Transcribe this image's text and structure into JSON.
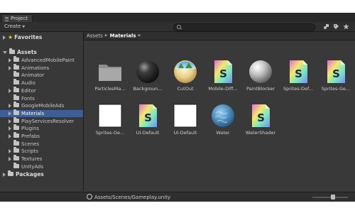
{
  "window": {
    "tab_title": "Project"
  },
  "toolbar": {
    "create_label": "Create",
    "search_value": "",
    "icons": [
      "search-icon",
      "filter-by-type-icon",
      "filter-by-label-icon",
      "favorites-star-icon"
    ]
  },
  "tree": {
    "favorites_label": "Favorites",
    "assets_label": "Assets",
    "packages_label": "Packages",
    "items": [
      {
        "label": "AdvancedMobilePaint",
        "expandable": true,
        "selected": false
      },
      {
        "label": "Animations",
        "expandable": true,
        "selected": false
      },
      {
        "label": "Animator",
        "expandable": false,
        "selected": false
      },
      {
        "label": "Audio",
        "expandable": false,
        "selected": false
      },
      {
        "label": "Editor",
        "expandable": true,
        "selected": false
      },
      {
        "label": "Fonts",
        "expandable": false,
        "selected": false
      },
      {
        "label": "GoogleMobileAds",
        "expandable": true,
        "selected": false
      },
      {
        "label": "Materials",
        "expandable": true,
        "selected": true
      },
      {
        "label": "PlayServicesResolver",
        "expandable": true,
        "selected": false
      },
      {
        "label": "Plugins",
        "expandable": true,
        "selected": false
      },
      {
        "label": "Prefabs",
        "expandable": true,
        "selected": false
      },
      {
        "label": "Scenes",
        "expandable": false,
        "selected": false
      },
      {
        "label": "Scripts",
        "expandable": true,
        "selected": false
      },
      {
        "label": "Textures",
        "expandable": true,
        "selected": false
      },
      {
        "label": "UnityAds",
        "expandable": false,
        "selected": false
      }
    ]
  },
  "breadcrumb": {
    "root": "Assets",
    "current": "Materials"
  },
  "assets": [
    {
      "label": "ParticlesMa...",
      "kind": "folder"
    },
    {
      "label": "Backgroun...",
      "kind": "dark-sphere"
    },
    {
      "label": "CutOut",
      "kind": "sky-sphere"
    },
    {
      "label": "Mobile-Diff...",
      "kind": "shader"
    },
    {
      "label": "PaintBlocker",
      "kind": "grey-sphere"
    },
    {
      "label": "Sprites-Def...",
      "kind": "shader"
    },
    {
      "label": "Sprites-Ge...",
      "kind": "shader"
    },
    {
      "label": "Sprites-Ge...",
      "kind": "white-square"
    },
    {
      "label": "UI-Default",
      "kind": "shader"
    },
    {
      "label": "UI-Default",
      "kind": "white-square"
    },
    {
      "label": "Water",
      "kind": "water-sphere"
    },
    {
      "label": "WaterShader",
      "kind": "shader"
    }
  ],
  "statusbar": {
    "path": "Assets/Scenes/Gameplay.unity"
  },
  "zoom_slider": {
    "value_fraction": 0.6
  },
  "colors": {
    "selection": "#3e5f96",
    "panel": "#383838",
    "favorite_star": "#f2c230"
  }
}
